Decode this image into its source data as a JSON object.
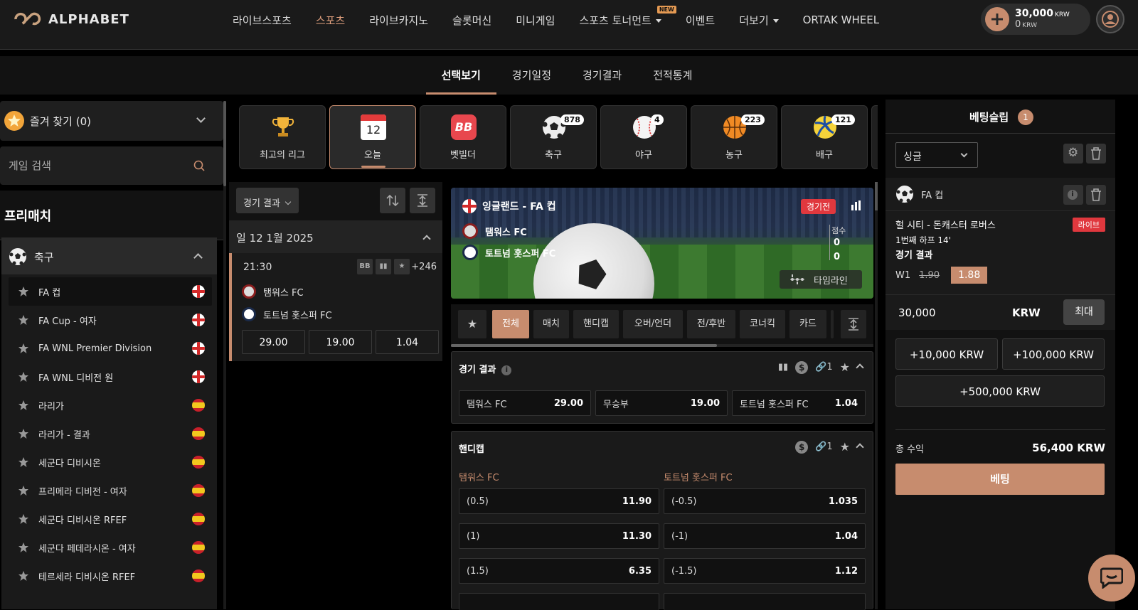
{
  "brand": {
    "name": "ALPHABET"
  },
  "nav": {
    "items": [
      "라이브스포츠",
      "스포츠",
      "라이브카지노",
      "슬롯머신",
      "미니게임",
      "스포츠 토너먼트",
      "이벤트",
      "더보기",
      "ORTAK WHEEL"
    ],
    "active": "스포츠",
    "new_badge": "NEW"
  },
  "wallet": {
    "balance": "30,000",
    "bonus": "0",
    "currency": "KRW"
  },
  "subnav": {
    "tabs": [
      "선택보기",
      "경기일정",
      "경기결과",
      "전적통계"
    ],
    "active": "선택보기"
  },
  "sidebar": {
    "favorites_label": "즐겨 찾기 (0)",
    "search_placeholder": "게임 검색",
    "section_title": "프리매치",
    "sport": "축구",
    "leagues": [
      {
        "name": "FA 컵",
        "flag": "england"
      },
      {
        "name": "FA Cup - 여자",
        "flag": "england"
      },
      {
        "name": "FA WNL Premier Division",
        "flag": "england"
      },
      {
        "name": "FA WNL 디비전 원",
        "flag": "england"
      },
      {
        "name": "라리가",
        "flag": "spain"
      },
      {
        "name": "라리가 - 결과",
        "flag": "spain"
      },
      {
        "name": "세군다 디비시온",
        "flag": "spain"
      },
      {
        "name": "프리메라 디비전 - 여자",
        "flag": "spain"
      },
      {
        "name": "세군다 디비시온 RFEF",
        "flag": "spain"
      },
      {
        "name": "세군다 페데라시온 - 여자",
        "flag": "spain"
      },
      {
        "name": "테르세라 디비시온 RFEF",
        "flag": "spain"
      }
    ]
  },
  "tiles": [
    {
      "label": "최고의 리그",
      "icon": "trophy-icon",
      "count": ""
    },
    {
      "label": "오늘",
      "icon": "calendar-icon",
      "count": "",
      "day": "12"
    },
    {
      "label": "벳빌더",
      "icon": "betbuilder-icon",
      "count": "",
      "text": "BB"
    },
    {
      "label": "축구",
      "icon": "soccer-ball-icon",
      "count": "878"
    },
    {
      "label": "야구",
      "icon": "baseball-icon",
      "count": "4"
    },
    {
      "label": "농구",
      "icon": "basketball-icon",
      "count": "223"
    },
    {
      "label": "배구",
      "icon": "volleyball-icon",
      "count": "121"
    }
  ],
  "matchlist": {
    "filter": "경기 결과",
    "date": "일 12 1월 2025",
    "match": {
      "time": "21:30",
      "badge_bb": "BB",
      "more_markets": "+246",
      "home": "탬워스 FC",
      "away": "토트넘 홋스퍼 FC",
      "odds": [
        "29.00",
        "19.00",
        "1.04"
      ]
    }
  },
  "banner": {
    "league": "잉글랜드 - FA 컵",
    "status": "경기전",
    "home": "탬워스 FC",
    "away": "토트넘 홋스퍼 FC",
    "score_label": "점수",
    "home_score": "0",
    "away_score": "0",
    "timeline": "타임라인"
  },
  "market_tabs": [
    "전체",
    "매치",
    "핸디캡",
    "오버/언더",
    "전/후반",
    "코너킥",
    "카드"
  ],
  "markets": {
    "result": {
      "title": "경기 결과",
      "link_count": "1",
      "options": [
        {
          "label": "탬워스 FC",
          "odd": "29.00"
        },
        {
          "label": "무승부",
          "odd": "19.00"
        },
        {
          "label": "토트넘 홋스퍼 FC",
          "odd": "1.04"
        }
      ]
    },
    "handicap": {
      "title": "핸디캡",
      "link_count": "1",
      "home_label": "탬워스 FC",
      "away_label": "토트넘 홋스퍼 FC",
      "rows": [
        {
          "home": "(0.5)",
          "home_odd": "11.90",
          "away": "(-0.5)",
          "away_odd": "1.035"
        },
        {
          "home": "(1)",
          "home_odd": "11.30",
          "away": "(-1)",
          "away_odd": "1.04"
        },
        {
          "home": "(1.5)",
          "home_odd": "6.35",
          "away": "(-1.5)",
          "away_odd": "1.12"
        }
      ]
    }
  },
  "betslip": {
    "title": "베팅슬립",
    "count": "1",
    "mode": "싱글",
    "sport": "FA 컵",
    "match": "헐 시티 - 돈캐스터 로버스",
    "live": "라이브",
    "period": "1번째 하프 14'",
    "market": "경기 결과",
    "selection": "W1",
    "old_odd": "1.90",
    "new_odd": "1.88",
    "stake": "30,000",
    "currency": "KRW",
    "max_label": "최대",
    "quick": [
      "+10,000 KRW",
      "+100,000 KRW",
      "+500,000 KRW"
    ],
    "total_label": "총 수익",
    "total_value": "56,400 KRW",
    "bet_label": "베팅"
  },
  "colors": {
    "accent": "#c78c6e",
    "live": "#e0383e",
    "bg": "#000000",
    "panel": "#1a1a1a"
  }
}
